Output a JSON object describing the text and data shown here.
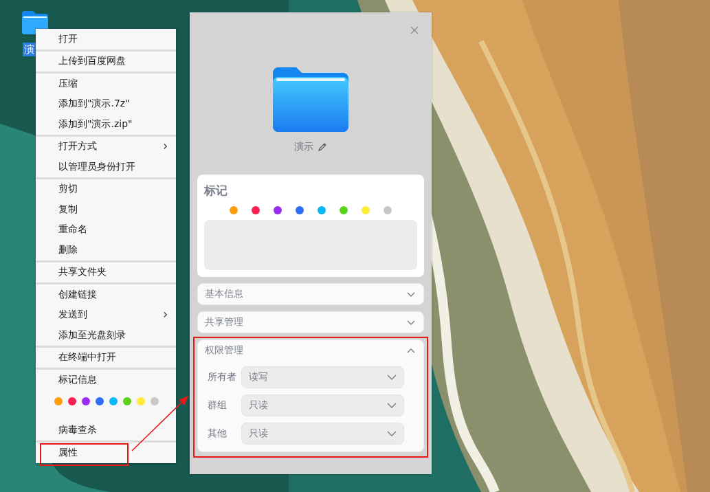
{
  "desktop": {
    "icon": {
      "label": "演",
      "selected": true
    }
  },
  "context_menu": {
    "groups": [
      [
        {
          "kind": "item",
          "label": "打开",
          "has_submenu": false
        }
      ],
      [
        {
          "kind": "item",
          "label": "上传到百度网盘",
          "has_submenu": false
        }
      ],
      [
        {
          "kind": "item",
          "label": "压缩",
          "has_submenu": false
        },
        {
          "kind": "item",
          "label": "添加到\"演示.7z\"",
          "has_submenu": false
        },
        {
          "kind": "item",
          "label": "添加到\"演示.zip\"",
          "has_submenu": false
        }
      ],
      [
        {
          "kind": "item",
          "label": "打开方式",
          "has_submenu": true
        },
        {
          "kind": "item",
          "label": "以管理员身份打开",
          "has_submenu": false
        }
      ],
      [
        {
          "kind": "item",
          "label": "剪切",
          "has_submenu": false
        },
        {
          "kind": "item",
          "label": "复制",
          "has_submenu": false
        },
        {
          "kind": "item",
          "label": "重命名",
          "has_submenu": false
        },
        {
          "kind": "item",
          "label": "删除",
          "has_submenu": false
        }
      ],
      [
        {
          "kind": "item",
          "label": "共享文件夹",
          "has_submenu": false
        }
      ],
      [
        {
          "kind": "item",
          "label": "创建链接",
          "has_submenu": false
        },
        {
          "kind": "item",
          "label": "发送到",
          "has_submenu": true
        },
        {
          "kind": "item",
          "label": "添加至光盘刻录",
          "has_submenu": false
        }
      ],
      [
        {
          "kind": "item",
          "label": "在终端中打开",
          "has_submenu": false
        }
      ],
      [
        {
          "kind": "item",
          "label": "标记信息",
          "has_submenu": false
        },
        {
          "kind": "tags",
          "colors": [
            {
              "color": "#ff9d0a"
            },
            {
              "color": "#ff1f4f"
            },
            {
              "color": "#9a2bf0"
            },
            {
              "color": "#2f6df6"
            },
            {
              "color": "#0ab8f8"
            },
            {
              "color": "#5bd31a"
            },
            {
              "color": "#ffea3a"
            },
            {
              "color": "#c8c8c8"
            }
          ]
        },
        {
          "kind": "item",
          "label": "病毒查杀",
          "has_submenu": false
        }
      ],
      [
        {
          "kind": "item",
          "label": "属性",
          "has_submenu": false
        }
      ]
    ]
  },
  "properties": {
    "name": "演示",
    "tags": {
      "title": "标记",
      "colors": [
        {
          "color": "#ff9d0a"
        },
        {
          "color": "#ff1f4f"
        },
        {
          "color": "#9a2bf0"
        },
        {
          "color": "#2f6df6"
        },
        {
          "color": "#0ab8f8"
        },
        {
          "color": "#5bd31a"
        },
        {
          "color": "#ffea3a"
        },
        {
          "color": "#c8c8c8"
        }
      ]
    },
    "sections": [
      {
        "title": "基本信息",
        "expanded": false,
        "highlighted": false
      },
      {
        "title": "共享管理",
        "expanded": false,
        "highlighted": false
      },
      {
        "title": "权限管理",
        "expanded": true,
        "highlighted": true,
        "rows": [
          {
            "label": "所有者",
            "value": "读写"
          },
          {
            "label": "群组",
            "value": "只读"
          },
          {
            "label": "其他",
            "value": "只读"
          }
        ]
      }
    ]
  }
}
